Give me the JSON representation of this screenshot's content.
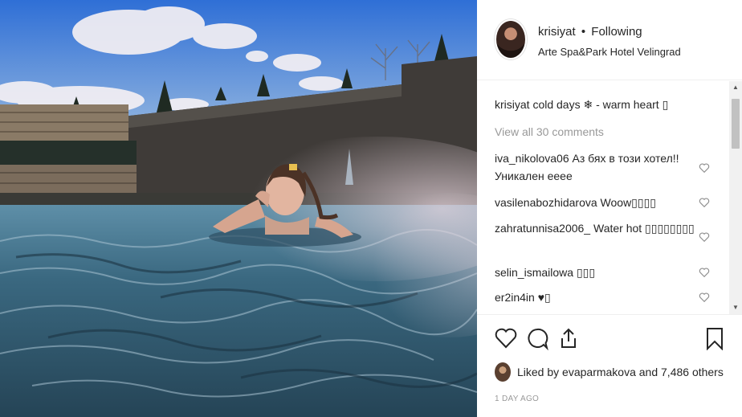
{
  "post": {
    "username": "krisiyat",
    "separator": "•",
    "follow_status": "Following",
    "location": "Arte Spa&Park Hotel Velingrad",
    "caption_user": "krisiyat",
    "caption_text": "cold days ❄ - warm heart ▯",
    "view_all_comments": "View all 30 comments",
    "comments": [
      {
        "user": "iva_nikolova06",
        "text": "Аз бях в този хотел!! Уникален еееe"
      },
      {
        "user": "vasilenabozhidarova",
        "text": "Woow▯▯▯▯"
      },
      {
        "user": "zahratunnisa2006_",
        "text": "Water hot ▯▯▯▯▯▯▯▯"
      },
      {
        "user": "selin_ismailowa",
        "text": "▯▯▯"
      },
      {
        "user": "er2in4in",
        "text": "♥▯"
      }
    ],
    "liked_by_prefix": "Liked by",
    "liked_by_user": "evaparmakova",
    "liked_by_suffix": "and 7,486 others",
    "time_ago": "1 DAY AGO"
  },
  "icons": {
    "like": "heart-icon",
    "comment": "comment-icon",
    "share": "share-icon",
    "save": "bookmark-icon",
    "comment_like": "heart-icon"
  },
  "colors": {
    "text": "#262626",
    "muted": "#999999",
    "border": "#efefef"
  }
}
